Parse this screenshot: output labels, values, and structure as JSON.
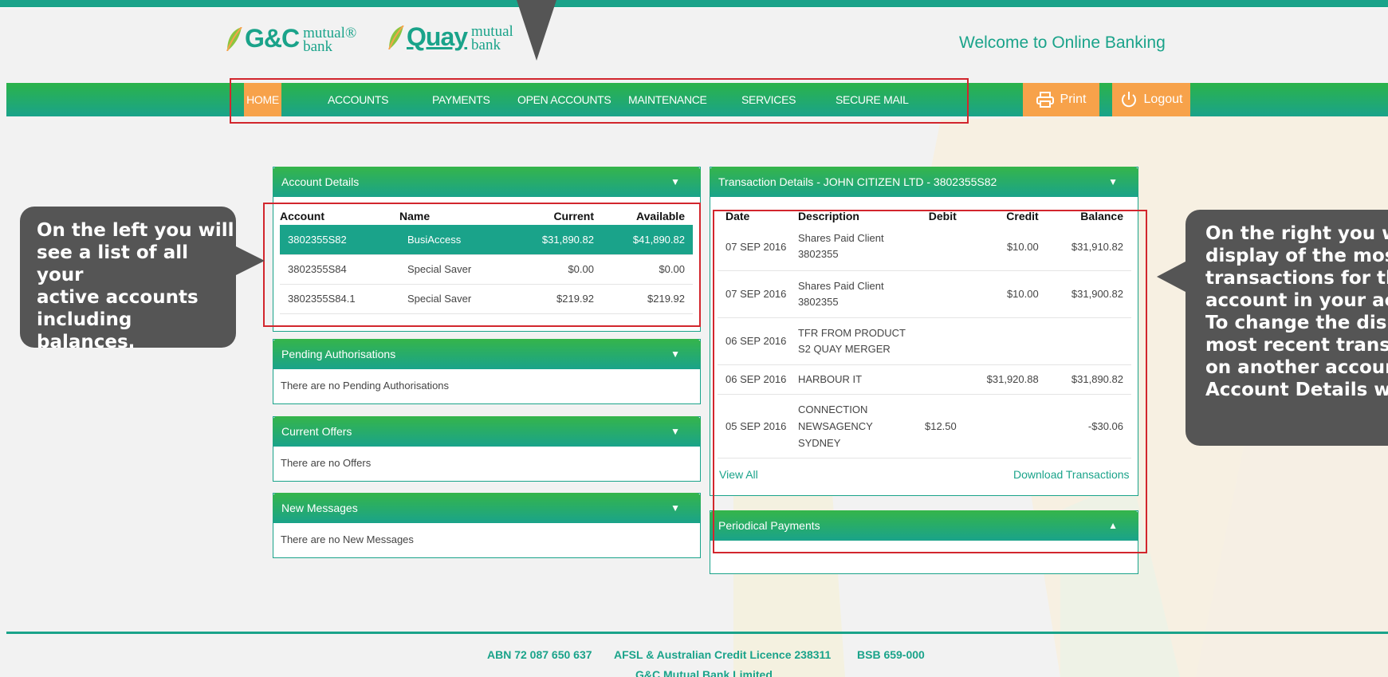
{
  "header": {
    "logos": {
      "gc": {
        "main": "G&C",
        "sub_top": "mutual®",
        "sub_bottom": "bank"
      },
      "quay": {
        "main": "Quay",
        "sub_top": "mutual",
        "sub_bottom": "bank"
      }
    },
    "welcome": "Welcome to Online Banking"
  },
  "nav": {
    "items": [
      "HOME",
      "ACCOUNTS",
      "PAYMENTS",
      "OPEN ACCOUNTS",
      "MAINTENANCE",
      "SERVICES",
      "SECURE MAIL"
    ],
    "print": "Print",
    "logout": "Logout"
  },
  "account_details": {
    "title": "Account Details",
    "columns": [
      "Account",
      "Name",
      "Current",
      "Available"
    ],
    "rows": [
      {
        "account": "3802355S82",
        "name": "BusiAccess",
        "current": "$31,890.82",
        "available": "$41,890.82",
        "selected": true
      },
      {
        "account": "3802355S84",
        "name": "Special Saver",
        "current": "$0.00",
        "available": "$0.00",
        "selected": false
      },
      {
        "account": "3802355S84.1",
        "name": "Special Saver",
        "current": "$219.92",
        "available": "$219.92",
        "selected": false
      }
    ]
  },
  "pending": {
    "title": "Pending Authorisations",
    "text": "There are no Pending Authorisations"
  },
  "offers": {
    "title": "Current Offers",
    "text": "There are no Offers"
  },
  "messages": {
    "title": "New Messages",
    "text": "There are no New Messages"
  },
  "transactions": {
    "title": "Transaction Details - JOHN CITIZEN LTD - 3802355S82",
    "columns": [
      "Date",
      "Description",
      "Debit",
      "Credit",
      "Balance"
    ],
    "rows": [
      {
        "date": "07 SEP 2016",
        "desc": [
          "Shares Paid Client",
          "3802355"
        ],
        "debit": "",
        "credit": "$10.00",
        "balance": "$31,910.82"
      },
      {
        "date": "07 SEP 2016",
        "desc": [
          "Shares Paid Client",
          "3802355"
        ],
        "debit": "",
        "credit": "$10.00",
        "balance": "$31,900.82"
      },
      {
        "date": "06 SEP 2016",
        "desc": [
          "TFR FROM PRODUCT",
          "S2 QUAY MERGER"
        ],
        "debit": "",
        "credit": "",
        "balance": ""
      },
      {
        "date": "06 SEP 2016",
        "desc": [
          "HARBOUR IT"
        ],
        "debit": "",
        "credit": "$31,920.88",
        "balance": "$31,890.82"
      },
      {
        "date": "05 SEP 2016",
        "desc": [
          "CONNECTION",
          "NEWSAGENCY",
          "SYDNEY"
        ],
        "debit": "$12.50",
        "credit": "",
        "balance": "-$30.06"
      }
    ],
    "view_all": "View All",
    "download": "Download Transactions"
  },
  "periodical": {
    "title": "Periodical Payments"
  },
  "callouts": {
    "left": [
      "On the left you will",
      "see a list of all your",
      "active accounts",
      "including balances."
    ],
    "right": [
      "On the right you w",
      "display of the most",
      "transactions for the",
      "account in your acc",
      "To change the disp",
      "most recent transac",
      "on another account",
      "Account Details wi"
    ]
  },
  "footer": {
    "abn": "ABN 72 087 650 637",
    "afsl": "AFSL & Australian Credit Licence 238311",
    "bsb": "BSB 659-000",
    "company": "G&C Mutual Bank Limited"
  },
  "colors": {
    "brand_teal": "#1aa38a",
    "brand_green": "#2bb34a",
    "accent_orange": "#f7a24a",
    "highlight_red": "#d2262d"
  }
}
